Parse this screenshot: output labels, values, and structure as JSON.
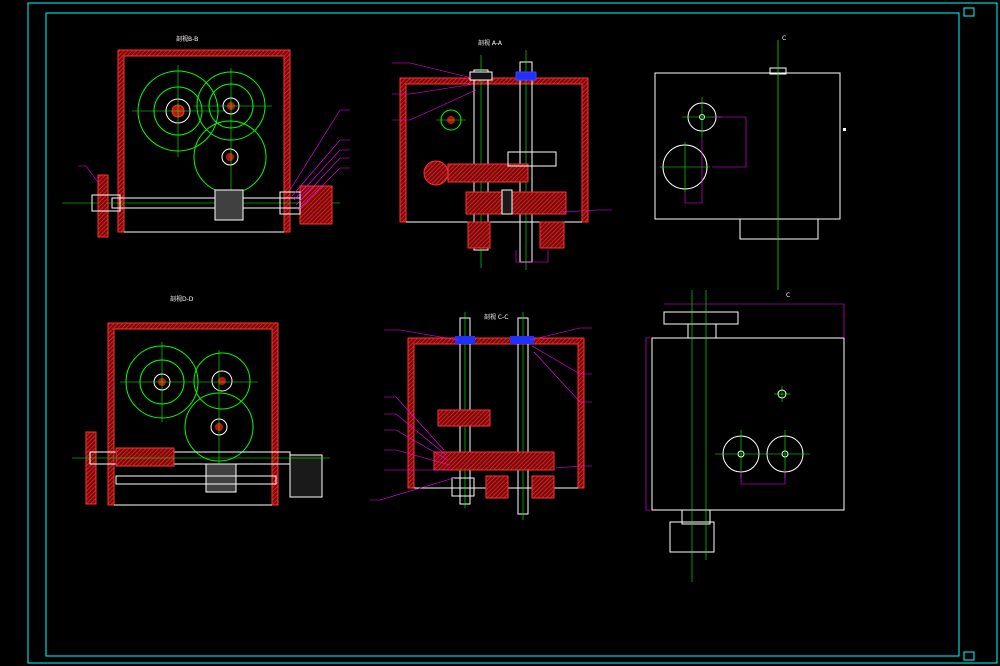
{
  "drawing": {
    "views": {
      "section_b": {
        "title": "剖视B-B"
      },
      "section_a": {
        "title": "剖视 A-A"
      },
      "section_d": {
        "title": "剖视D-D"
      },
      "section_c": {
        "title": "剖视 C-C"
      },
      "side_view": {
        "label_top": "C",
        "label_bottom": "C"
      },
      "top_view": {}
    },
    "colors": {
      "frame": "#00ffff",
      "outline": "#ffffff",
      "center": "#00ff00",
      "section": "#ff2020",
      "dimension": "#ff00ff",
      "bolt": "#4040ff",
      "housing": "#c01010"
    }
  }
}
